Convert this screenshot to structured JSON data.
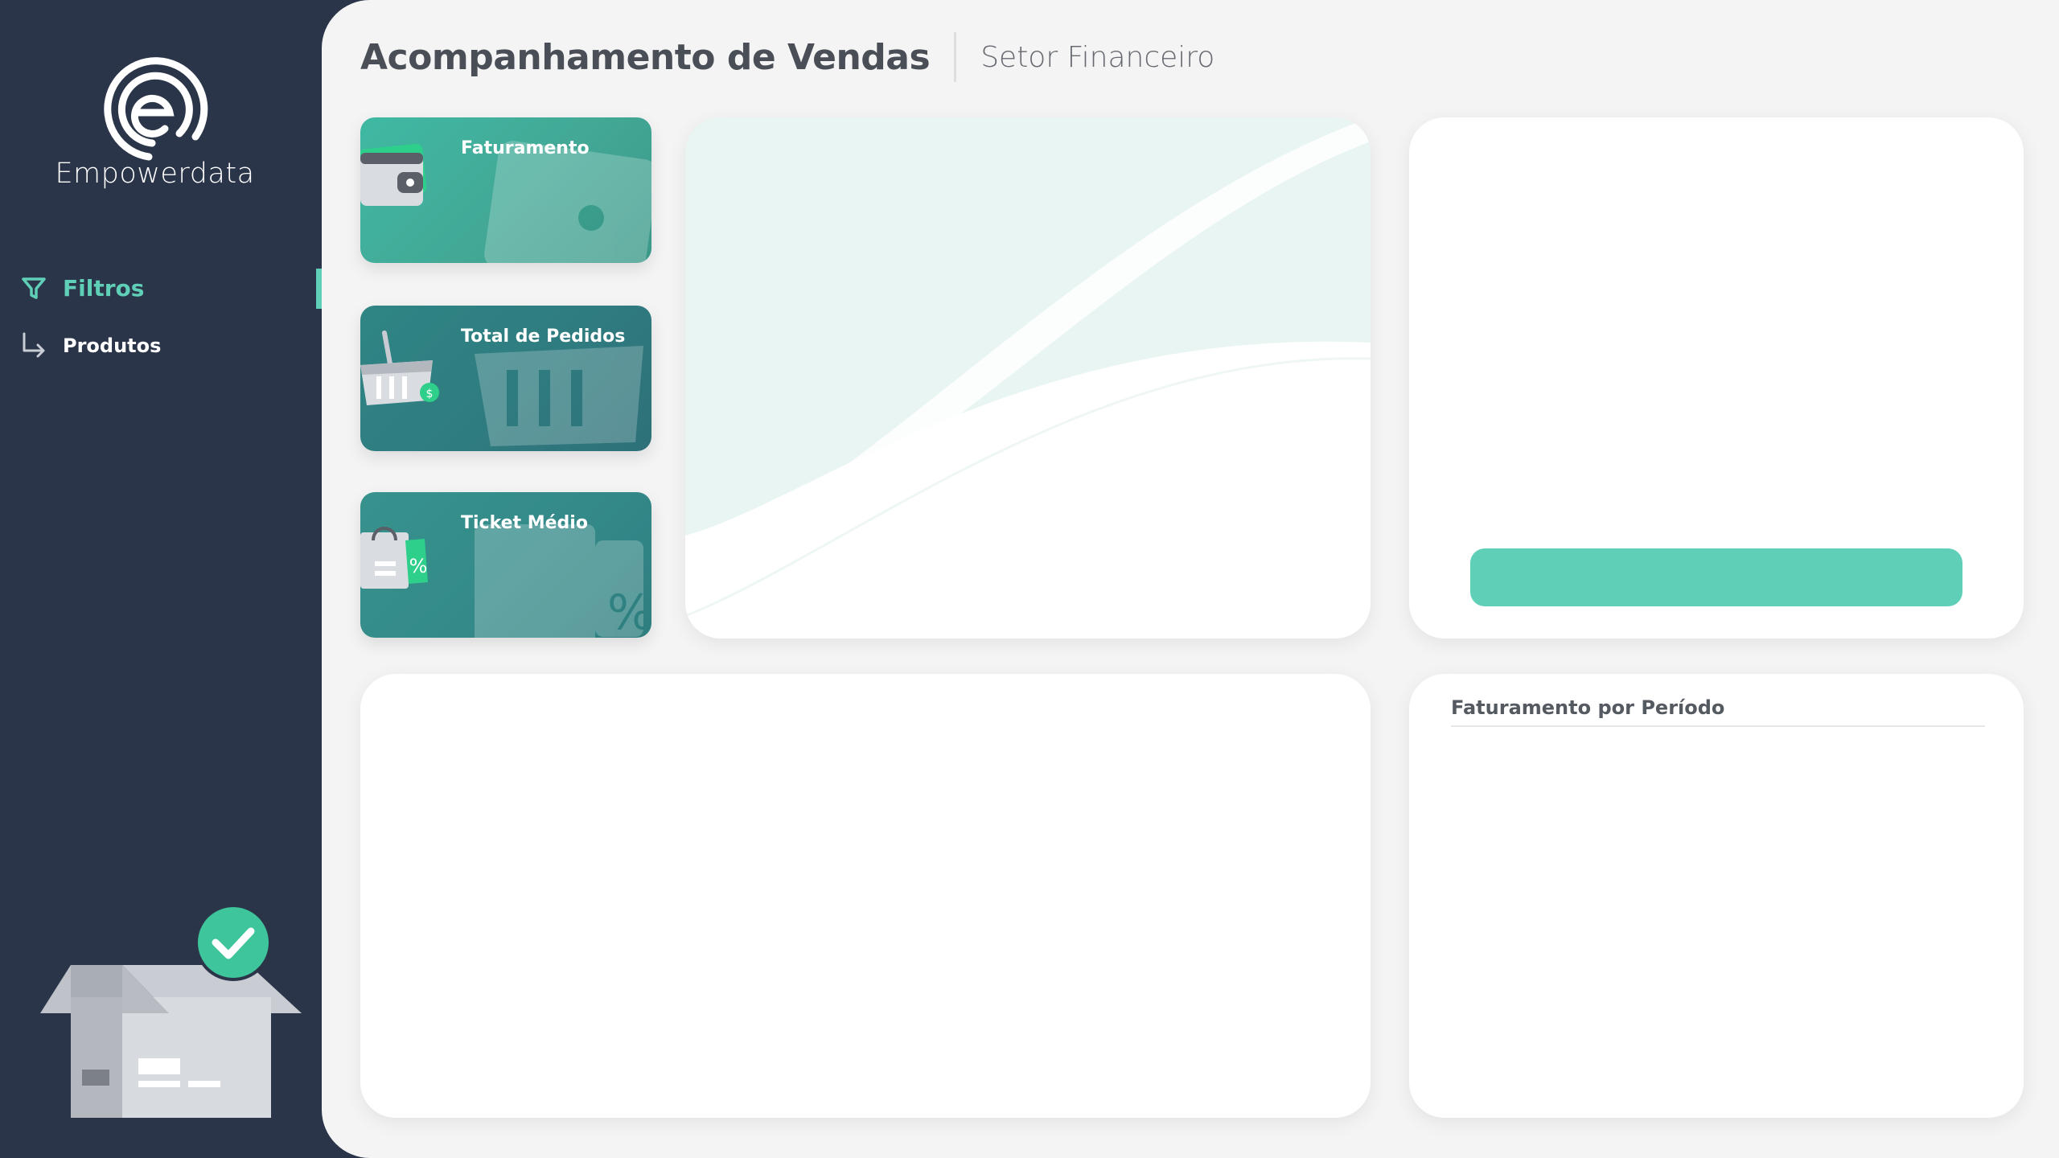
{
  "brand": {
    "name": "Empowerdata",
    "accent_color": "#5fd0b7",
    "sidebar_color": "#2b3549"
  },
  "sidebar": {
    "items": [
      {
        "label": "Filtros",
        "icon": "filter-icon",
        "active": true
      },
      {
        "label": "Produtos",
        "icon": "arrow-turn-down-right-icon",
        "active": false
      }
    ],
    "illustration": "box-check-icon"
  },
  "header": {
    "title": "Acompanhamento de Vendas",
    "subtitle": "Setor Financeiro"
  },
  "kpis": [
    {
      "label": "Faturamento",
      "icon": "wallet-icon"
    },
    {
      "label": "Total de Pedidos",
      "icon": "basket-icon"
    },
    {
      "label": "Ticket Médio",
      "icon": "shopping-bag-icon"
    }
  ],
  "panels": {
    "period": {
      "title": "Faturamento por Período"
    },
    "filter_button": {
      "color": "#5fd0b7"
    }
  }
}
